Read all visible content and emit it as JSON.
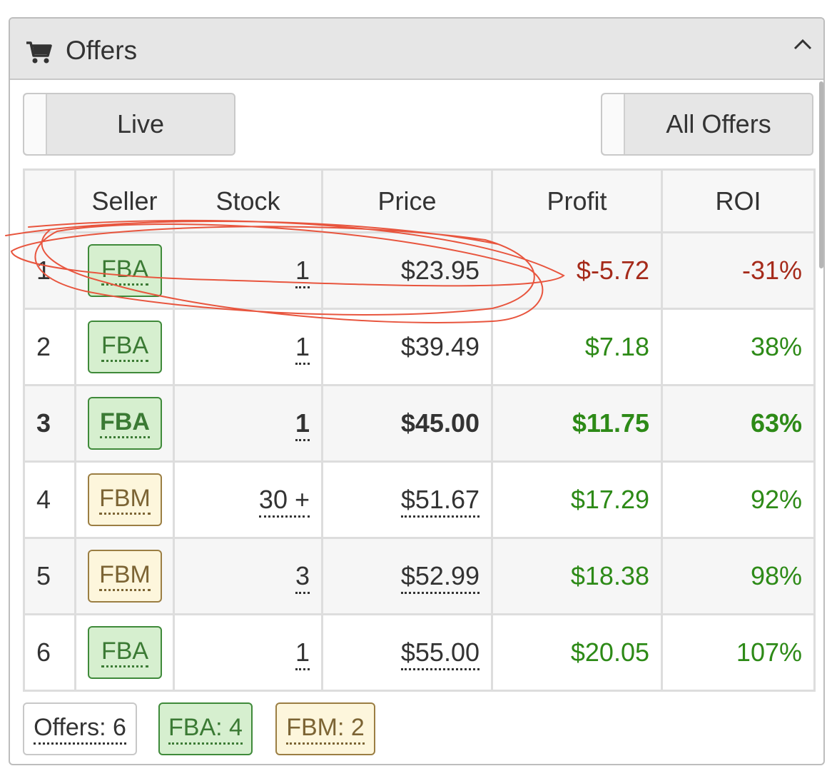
{
  "header": {
    "title": "Offers",
    "icon": "cart-icon",
    "collapse_icon": "chevron-up-icon"
  },
  "toggles": {
    "live_label": "Live",
    "all_offers_label": "All Offers"
  },
  "table": {
    "headers": [
      "",
      "Seller",
      "Stock",
      "Price",
      "Profit",
      "ROI"
    ],
    "rows": [
      {
        "num": "1",
        "seller": "FBA",
        "stock": "1",
        "price": "$23.95",
        "profit": "$-5.72",
        "roi": "-31%",
        "positive": false
      },
      {
        "num": "2",
        "seller": "FBA",
        "stock": "1",
        "price": "$39.49",
        "profit": "$7.18",
        "roi": "38%",
        "positive": true
      },
      {
        "num": "3",
        "seller": "FBA",
        "stock": "1",
        "price": "$45.00",
        "profit": "$11.75",
        "roi": "63%",
        "positive": true
      },
      {
        "num": "4",
        "seller": "FBM",
        "stock": "30 +",
        "price": "$51.67",
        "profit": "$17.29",
        "roi": "92%",
        "positive": true
      },
      {
        "num": "5",
        "seller": "FBM",
        "stock": "3",
        "price": "$52.99",
        "profit": "$18.38",
        "roi": "98%",
        "positive": true
      },
      {
        "num": "6",
        "seller": "FBA",
        "stock": "1",
        "price": "$55.00",
        "profit": "$20.05",
        "roi": "107%",
        "positive": true
      }
    ]
  },
  "footer": {
    "offers_count": "Offers: 6",
    "fba_count": "FBA: 4",
    "fbm_count": "FBM: 2"
  },
  "colors": {
    "negative": "#a52a1a",
    "positive": "#2d8a17",
    "fba_bg": "#d6efcf",
    "fbm_bg": "#fdf6dc",
    "annotation": "#e8553e"
  }
}
